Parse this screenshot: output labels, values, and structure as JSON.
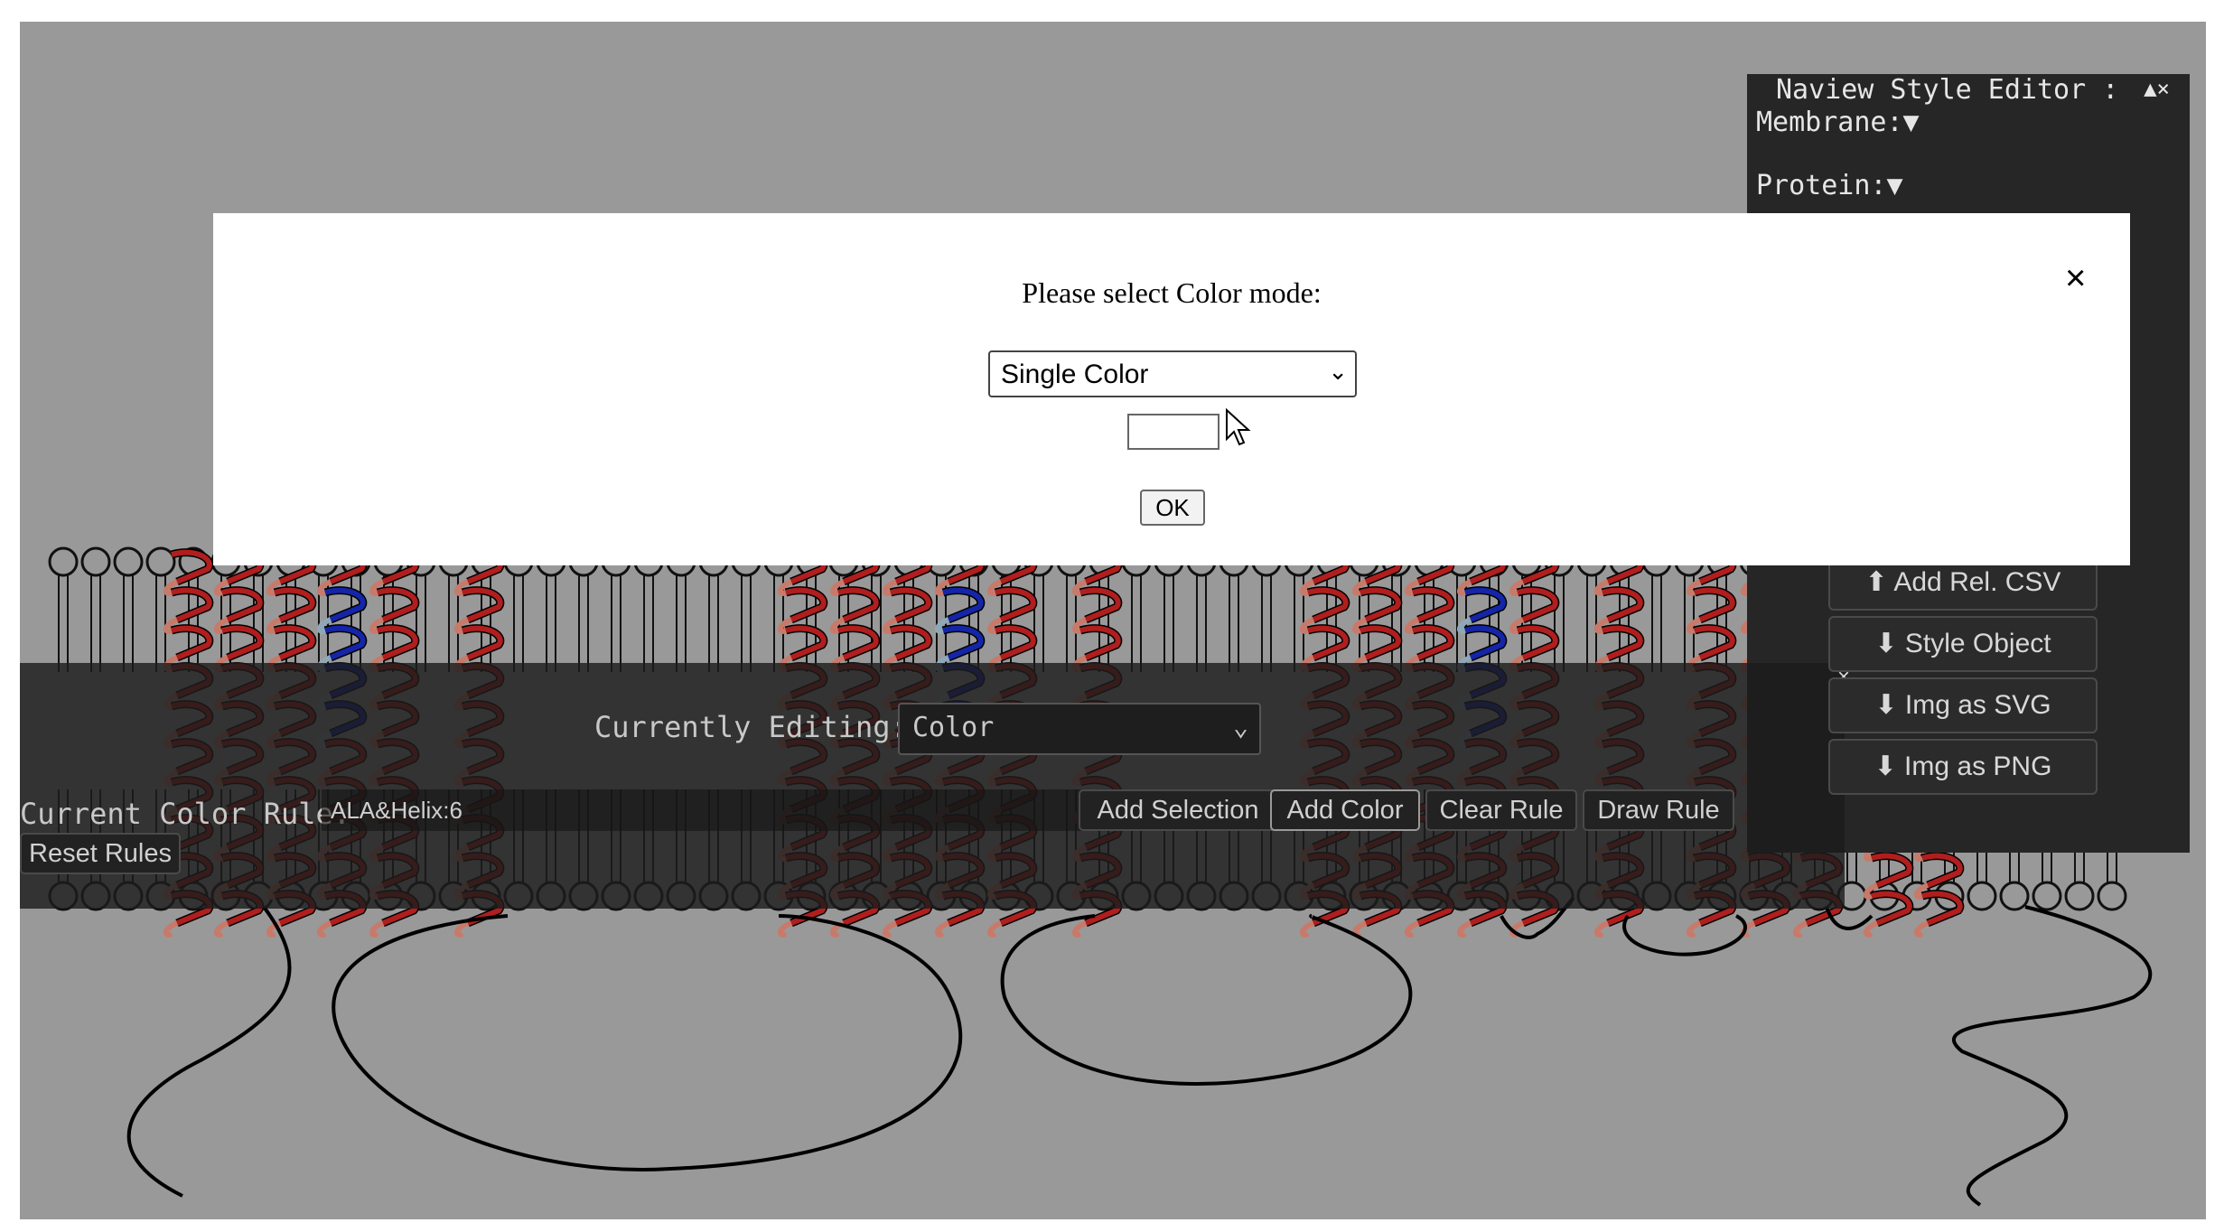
{
  "style_editor": {
    "title": "Naview Style Editor :",
    "controls": "▲×",
    "membrane_label": "Membrane:▼",
    "protein_label": "Protein:▼"
  },
  "modal": {
    "title": "Please select Color mode:",
    "close_symbol": "×",
    "mode_value": "Single Color",
    "color_value": "",
    "ok_label": "OK"
  },
  "editor": {
    "currently_editing_label": "Currently Editing:",
    "currently_editing_value": "Color",
    "current_rule_label": "Current Color Rule:",
    "current_rule_value": "ALA&Helix:6",
    "buttons": {
      "add_selection": "Add Selection",
      "add_color": "Add Color",
      "clear_rule": "Clear Rule",
      "draw_rule": "Draw Rule",
      "reset_rules": "Reset Rules"
    }
  },
  "side_panel": {
    "close_symbol": "×",
    "buttons": [
      "⬆ Add Rel. CSV",
      "⬇ Style Object",
      "⬇ Img as SVG",
      "⬇ Img as PNG"
    ]
  },
  "colors": {
    "background": "#999999",
    "helix_red": "#b01e1e",
    "helix_light_red": "#c87a6a",
    "helix_blue": "#1525a8",
    "helix_light_blue": "#8fa8b8",
    "panel_dark": "#262626"
  }
}
